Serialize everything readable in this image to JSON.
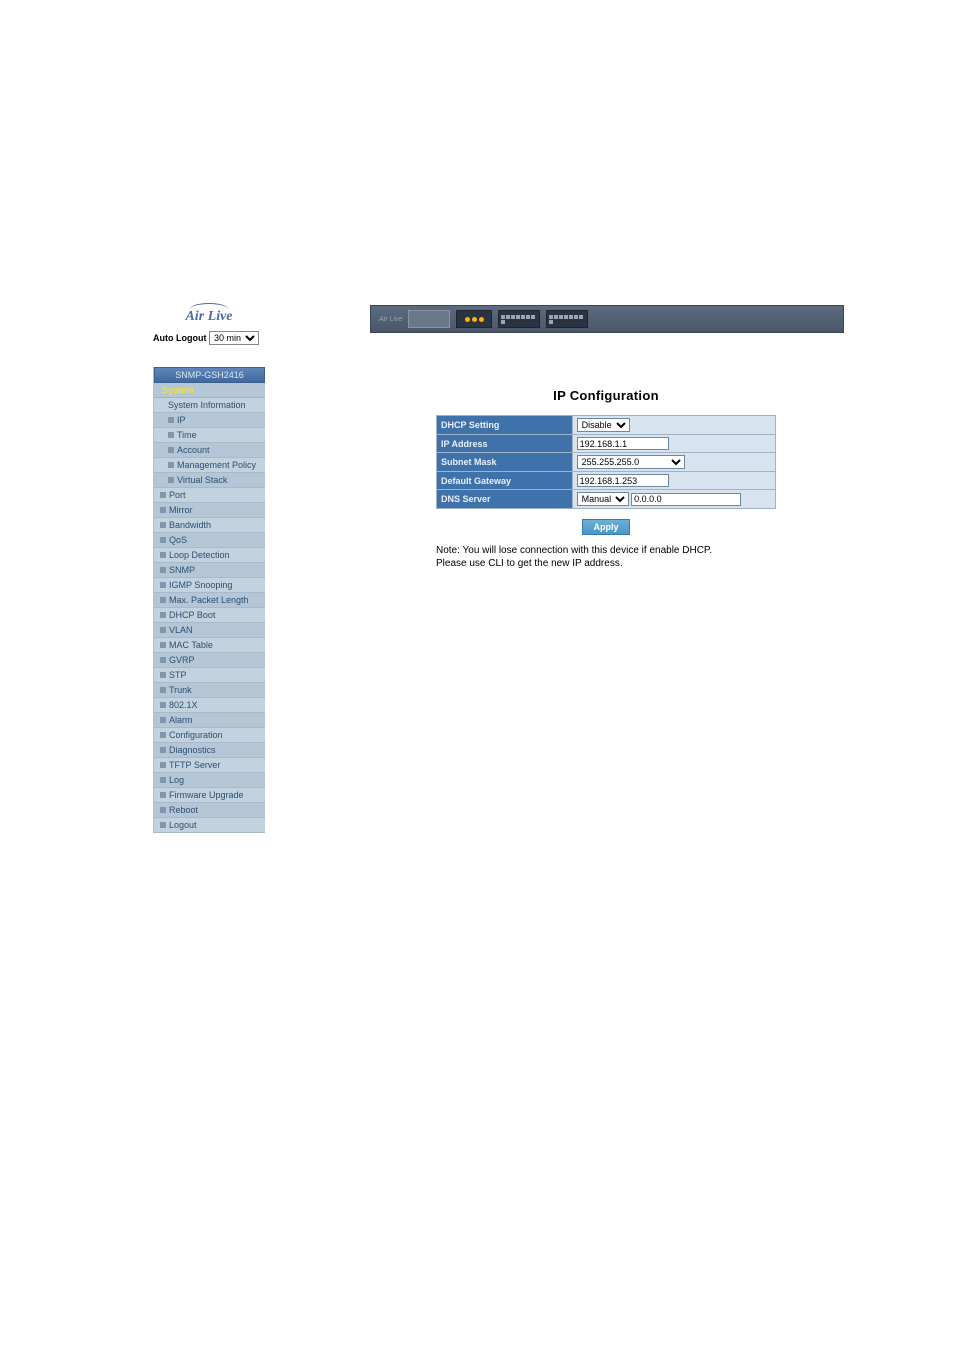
{
  "logo": {
    "brand": "Air Live"
  },
  "autologout": {
    "label": "Auto Logout",
    "selected": "30 min"
  },
  "device_name": "SNMP-GSH2416",
  "nav": {
    "group": "System",
    "children": [
      "System Information",
      "IP",
      "Time",
      "Account",
      "Management Policy",
      "Virtual Stack"
    ],
    "items": [
      "Port",
      "Mirror",
      "Bandwidth",
      "QoS",
      "Loop Detection",
      "SNMP",
      "IGMP Snooping",
      "Max. Packet Length",
      "DHCP Boot",
      "VLAN",
      "MAC Table",
      "GVRP",
      "STP",
      "Trunk",
      "802.1X",
      "Alarm",
      "Configuration",
      "Diagnostics",
      "TFTP Server",
      "Log",
      "Firmware Upgrade",
      "Reboot",
      "Logout"
    ]
  },
  "main": {
    "title": "IP Configuration",
    "rows": {
      "dhcp": {
        "label": "DHCP Setting",
        "value": "Disable"
      },
      "ip": {
        "label": "IP Address",
        "value": "192.168.1.1"
      },
      "mask": {
        "label": "Subnet Mask",
        "value": "255.255.255.0"
      },
      "gw": {
        "label": "Default Gateway",
        "value": "192.168.1.253"
      },
      "dns": {
        "label": "DNS Server",
        "mode": "Manual",
        "value": "0.0.0.0"
      }
    },
    "apply": "Apply",
    "note_line1": "Note: You will lose connection with this device if enable DHCP.",
    "note_line2": "Please use CLI to get the new IP address."
  },
  "banner_brand": "Air Live"
}
